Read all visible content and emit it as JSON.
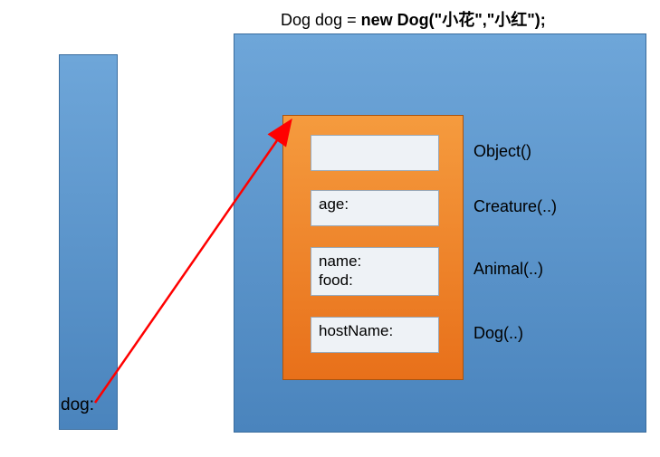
{
  "code": {
    "type": "Dog",
    "var": "dog",
    "eq": "=",
    "new": "new",
    "ctor": "Dog",
    "args": "(\"小花\",\"小红\");"
  },
  "leftLabel": "dog:",
  "fields": {
    "object": "",
    "creature": "age:",
    "animal_name": "name:",
    "animal_food": "food:",
    "dog": "hostName:"
  },
  "constructors": {
    "object": "Object()",
    "creature": "Creature(..)",
    "animal": "Animal(..)",
    "dog": "Dog(..)"
  }
}
